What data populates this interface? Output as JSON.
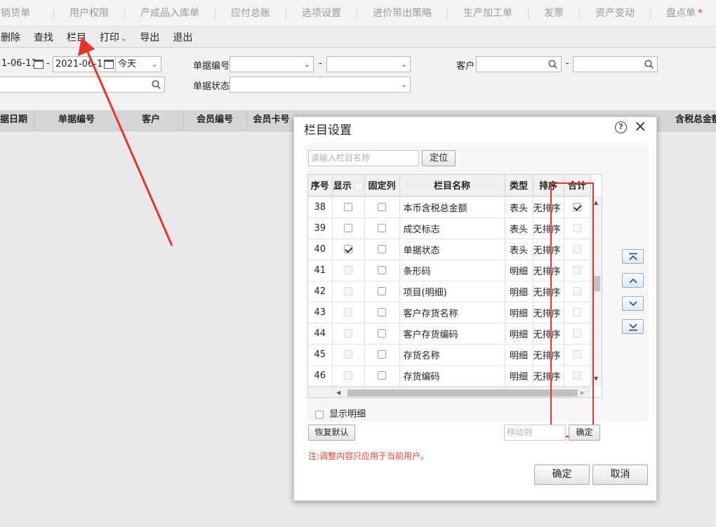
{
  "tabs": [
    "销货单",
    "用户权限",
    "产成品入库单",
    "应付总账",
    "选项设置",
    "进价带出策略",
    "生产加工单",
    "发票",
    "资产变动",
    "盘点单"
  ],
  "tab_modified_mark": "*",
  "toolbar": {
    "delete": "删除",
    "find": "查找",
    "columns": "栏目",
    "print": "打印",
    "export": "导出",
    "exit": "退出"
  },
  "filters": {
    "date_from": "1-06-11",
    "date_to": "2021-06-1",
    "dash": "-",
    "period": "今天",
    "doc_no_label": "单据编号",
    "doc_status_label": "单据状态",
    "customer_label": "客户"
  },
  "list_headers": [
    "据日期",
    "单据编号",
    "客户",
    "会员编号",
    "会员卡号",
    "含税总金额"
  ],
  "dialog": {
    "title": "栏目设置",
    "help": "?",
    "close": "×",
    "search_placeholder": "请输入栏目名称",
    "locate": "定位",
    "headers": {
      "no": "序号",
      "show": "显示",
      "fixed": "固定列",
      "name": "栏目名称",
      "type": "类型",
      "sort": "排序",
      "sum": "合计"
    },
    "rows": [
      {
        "no": "38",
        "show": "off",
        "fixed": "off",
        "name": "本币含税总金额",
        "type": "表头",
        "sort": "无排序",
        "sum": "on"
      },
      {
        "no": "39",
        "show": "off",
        "fixed": "off",
        "name": "成交标志",
        "type": "表头",
        "sort": "无排序",
        "sum": "dis"
      },
      {
        "no": "40",
        "show": "on",
        "fixed": "off",
        "name": "单据状态",
        "type": "表头",
        "sort": "无排序",
        "sum": "dis"
      },
      {
        "no": "41",
        "show": "dis",
        "fixed": "off",
        "name": "条形码",
        "type": "明细",
        "sort": "无排序",
        "sum": "dis"
      },
      {
        "no": "42",
        "show": "dis",
        "fixed": "off",
        "name": "项目(明细)",
        "type": "明细",
        "sort": "无排序",
        "sum": "dis"
      },
      {
        "no": "43",
        "show": "dis",
        "fixed": "off",
        "name": "客户存货名称",
        "type": "明细",
        "sort": "无排序",
        "sum": "dis"
      },
      {
        "no": "44",
        "show": "dis",
        "fixed": "off",
        "name": "客户存货编码",
        "type": "明细",
        "sort": "无排序",
        "sum": "dis"
      },
      {
        "no": "45",
        "show": "dis",
        "fixed": "off",
        "name": "存货名称",
        "type": "明细",
        "sort": "无排序",
        "sum": "dis"
      },
      {
        "no": "46",
        "show": "dis",
        "fixed": "off",
        "name": "存货编码",
        "type": "明细",
        "sort": "无排序",
        "sum": "dis"
      }
    ],
    "show_detail": "显示明细",
    "restore": "恢复默认",
    "move_to_placeholder": "移动到",
    "move_confirm": "确定",
    "note": "注:调整内容只应用于当前用户。",
    "ok": "确定",
    "cancel": "取消"
  },
  "colors": {
    "annotation": "#e8332e",
    "note": "#e0452a",
    "period_placeholder_color": "#b0b0b0"
  }
}
